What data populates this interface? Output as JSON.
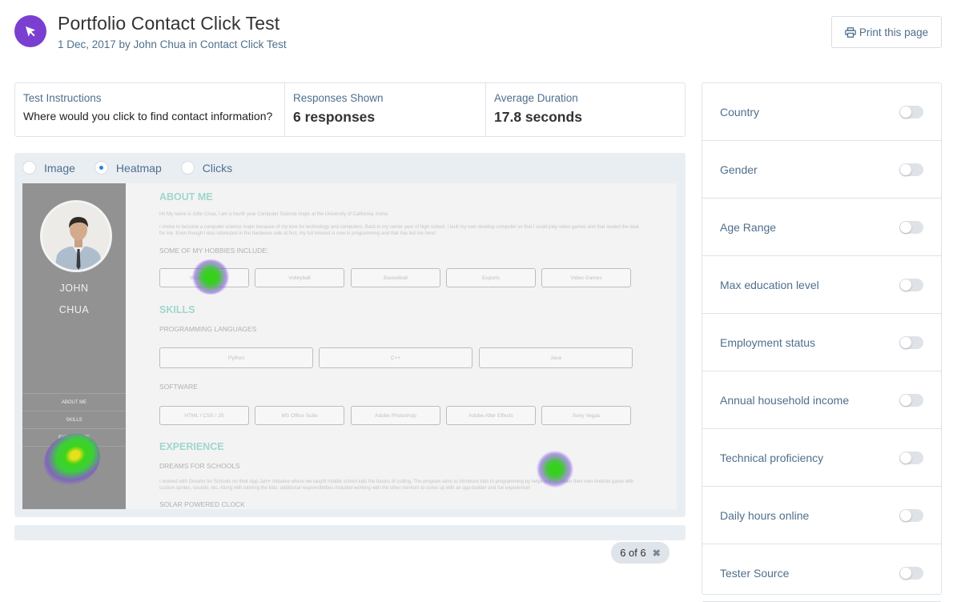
{
  "header": {
    "title": "Portfolio Contact Click Test",
    "meta": "1 Dec, 2017 by John Chua in Contact Click Test",
    "print_label": "Print this page",
    "logo_color": "#7a3fd0"
  },
  "stats": {
    "instructions_label": "Test Instructions",
    "instructions_value": "Where would you click to find contact information?",
    "responses_label": "Responses Shown",
    "responses_value": "6 responses",
    "duration_label": "Average Duration",
    "duration_value": "17.8 seconds"
  },
  "view_modes": {
    "options": [
      "Image",
      "Heatmap",
      "Clicks"
    ],
    "selected": "Heatmap"
  },
  "screenshot": {
    "first_name": "JOHN",
    "last_name": "CHUA",
    "nav": [
      "ABOUT ME",
      "SKILLS",
      "EXPERIENCE",
      "CONTACT"
    ],
    "about_heading": "ABOUT ME",
    "about_p1": "Hi! My name is John Chua, I am a fourth year Computer Science major at the University of California, Irvine.",
    "about_p2": "I chose to become a computer science major because of my love for technology and computers. Back in my senior year of high school, I built my own desktop computer so that I could play video games and that sealed the deal for me. Even though I was interested in the hardware side at first, my full interest is now in programming and that has led me here!",
    "hobbies_heading": "SOME OF MY HOBBIES INCLUDE:",
    "hobbies": [
      "Working Out",
      "Volleyball",
      "Basketball",
      "Esports",
      "Video Games"
    ],
    "skills_heading": "SKILLS",
    "languages_heading": "PROGRAMMING LANGUAGES",
    "languages": [
      "Python",
      "C++",
      "Java"
    ],
    "software_heading": "SOFTWARE",
    "software": [
      "HTML / CSS / JS",
      "MS Office Suite",
      "Adobe Photoshop",
      "Adobe After Effects",
      "Sony Vegas"
    ],
    "experience_heading": "EXPERIENCE",
    "dreams_heading": "DREAMS FOR SCHOOLS",
    "dreams_p": "I worked with Dreams for Schools on their App Jam+ initiative where we taught middle school kids the basics of coding. The program aims to introduce kids to programming by helping them make their own Android game with custom sprites, sounds, etc. Along with tutoring the kids, additional responsibilities included working with the other mentors to come up with an app-builder and fun experience!",
    "solar_heading": "SOLAR POWERED CLOCK"
  },
  "pager": {
    "label": "6 of 6"
  },
  "filters": [
    {
      "label": "Country",
      "on": false
    },
    {
      "label": "Gender",
      "on": false
    },
    {
      "label": "Age Range",
      "on": false
    },
    {
      "label": "Max education level",
      "on": false
    },
    {
      "label": "Employment status",
      "on": false
    },
    {
      "label": "Annual household income",
      "on": false
    },
    {
      "label": "Technical proficiency",
      "on": false
    },
    {
      "label": "Daily hours online",
      "on": false
    },
    {
      "label": "Tester Source",
      "on": false
    }
  ]
}
